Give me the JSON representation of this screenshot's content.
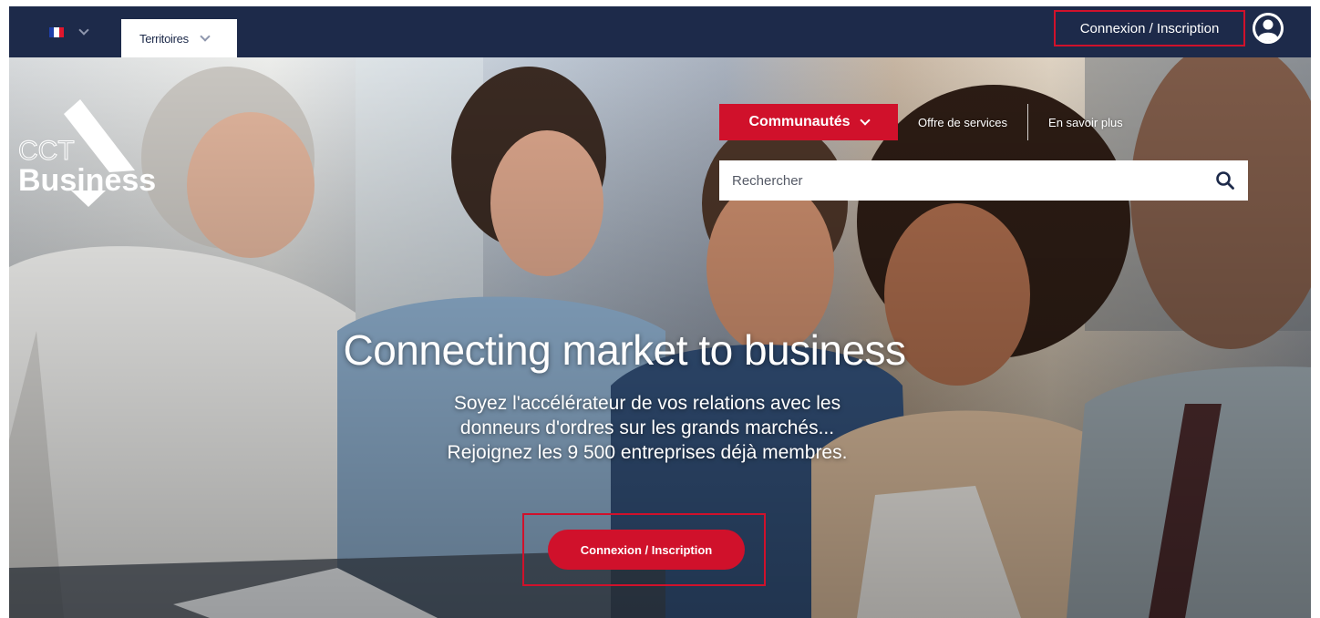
{
  "topbar": {
    "language_flag": "flag-fr-icon",
    "territoires_label": "Territoires",
    "login_label": "Connexion / Inscription",
    "avatar_icon": "user-avatar-icon"
  },
  "logo": {
    "line1": "CCT",
    "line2": "Business"
  },
  "nav": {
    "communautes_label": "Communautés",
    "offre_label": "Offre de services",
    "savoir_label": "En savoir plus"
  },
  "search": {
    "placeholder": "Rechercher",
    "icon": "search-icon"
  },
  "hero": {
    "headline": "Connecting market to business",
    "subline": "Soyez l'accélérateur de vos relations avec les donneurs d'ordres sur les grands marchés... Rejoignez les 9 500 entreprises déjà membres.",
    "cta_label": "Connexion / Inscription"
  },
  "colors": {
    "navy": "#1d2a4a",
    "brand_red": "#d0112b",
    "white": "#ffffff"
  }
}
